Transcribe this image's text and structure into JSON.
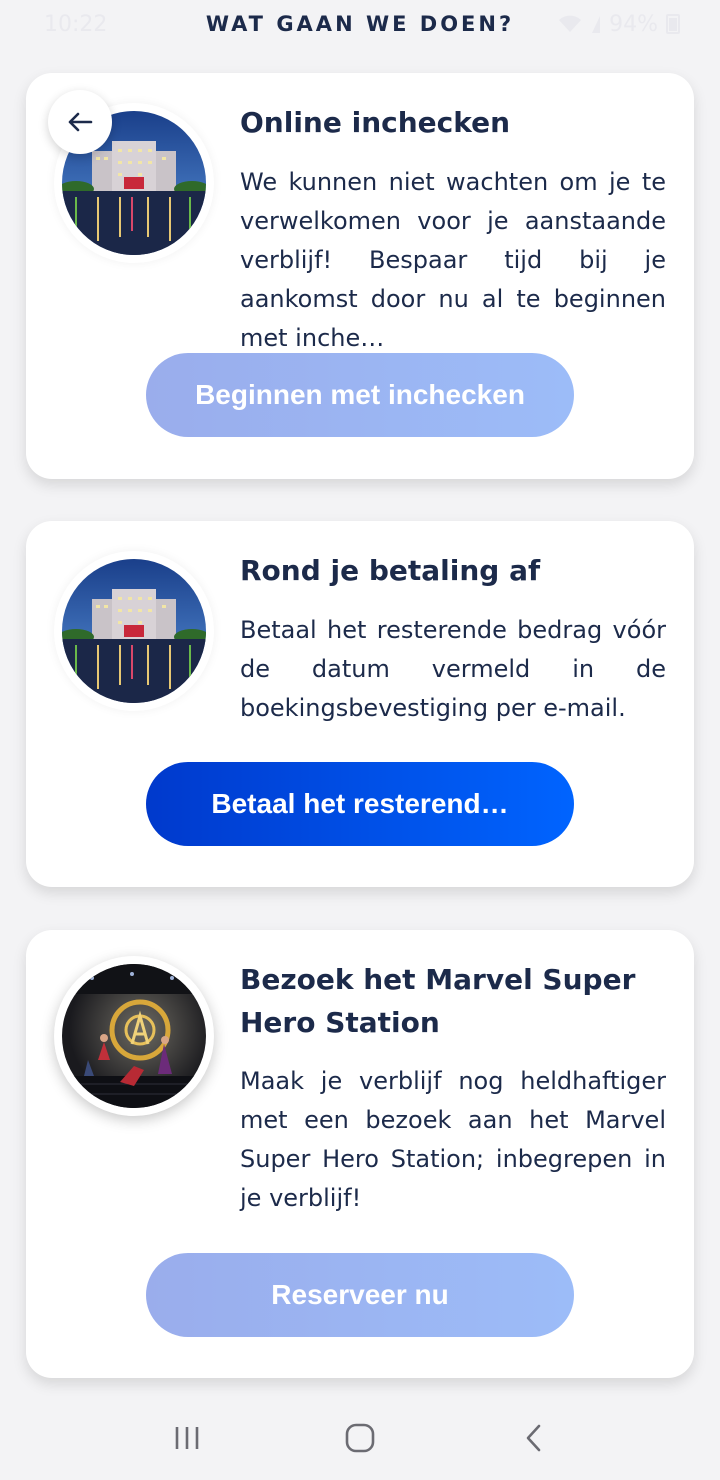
{
  "status_bar": {
    "time": "10:22",
    "battery": "94%",
    "icons": [
      "wifi-icon",
      "signal-icon",
      "battery-icon"
    ]
  },
  "header": {
    "title": "WAT GAAN WE DOEN?",
    "back_icon": "arrow-left-icon"
  },
  "cards": [
    {
      "title": "Online inchecken",
      "text": "We kunnen niet wachten om je te verwelkomen voor je aanstaande verblijf! Bespaar tijd bij je aankomst door nu al te beginnen met inche…",
      "button_label": "Beginnen met inchecken",
      "button_state": "disabled",
      "image": "hotel-at-night-image"
    },
    {
      "title": "Rond je betaling af",
      "text": "Betaal het resterende bedrag vóór de datum vermeld in de boekingsbevestiging per e-mail.",
      "button_label": "Betaal het resterend…",
      "button_state": "active",
      "image": "hotel-at-night-image"
    },
    {
      "title": "Bezoek het Marvel Super Hero Station",
      "text": "Maak je verblijf nog heldhaftiger met een bezoek aan het Marvel Super Hero Station; inbegrepen in je verblijf!",
      "button_label": "Reserveer nu",
      "button_state": "disabled",
      "image": "marvel-station-image"
    }
  ],
  "nav_bar": {
    "icons": [
      "recent-apps-icon",
      "home-icon",
      "back-icon"
    ]
  },
  "colors": {
    "title_text": "#1c2a4a",
    "button_active": "#0050f0",
    "button_disabled": "#9cb3f0",
    "background": "#f3f3f5"
  }
}
